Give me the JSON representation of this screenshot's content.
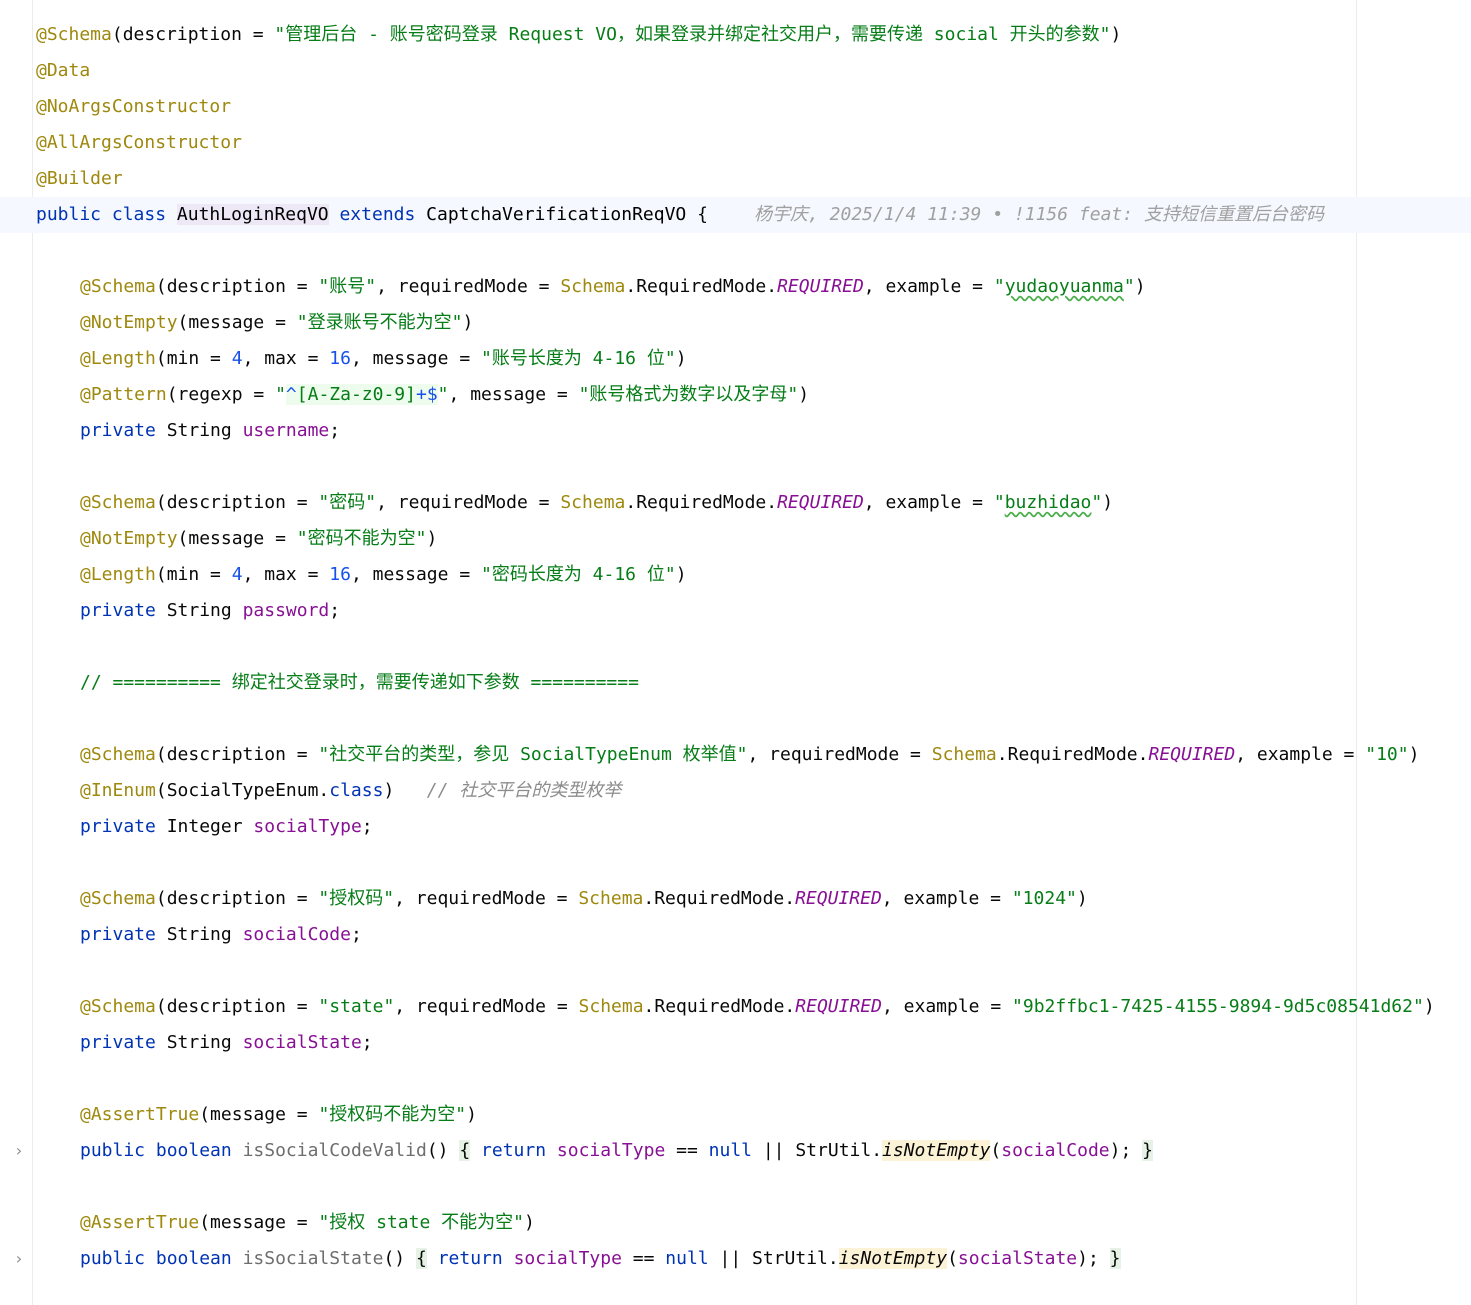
{
  "editor": {
    "lines": {
      "l1": {
        "ann": "@Schema",
        "p1": "(description = ",
        "str": "\"管理后台 - 账号密码登录 Request VO，如果登录并绑定社交用户，需要传递 social 开头的参数\"",
        "p2": ")"
      },
      "l2": {
        "ann": "@Data"
      },
      "l3": {
        "ann": "@NoArgsConstructor"
      },
      "l4": {
        "ann": "@AllArgsConstructor"
      },
      "l5": {
        "ann": "@Builder"
      },
      "l6": {
        "kw1": "public",
        "kw2": "class",
        "cls": "AuthLoginReqVO",
        "kw3": "extends",
        "parent": "CaptchaVerificationReqVO",
        "brace": "{",
        "blame": "杨宇庆, 2025/1/4 11:39 • !1156 feat: 支持短信重置后台密码"
      },
      "l8": {
        "ann": "@Schema",
        "p1": "(description = ",
        "str1": "\"账号\"",
        "p2": ", requiredMode = ",
        "schema": "Schema",
        "p3": ".RequiredMode.",
        "req": "REQUIRED",
        "p4": ", example = ",
        "q1": "\"",
        "example": "yudaoyuanma",
        "q2": "\"",
        "p5": ")"
      },
      "l9": {
        "ann": "@NotEmpty",
        "p1": "(message = ",
        "str": "\"登录账号不能为空\"",
        "p2": ")"
      },
      "l10": {
        "ann": "@Length",
        "p1": "(min = ",
        "n1": "4",
        "p2": ", max = ",
        "n2": "16",
        "p3": ", message = ",
        "str": "\"账号长度为 4-16 位\"",
        "p4": ")"
      },
      "l11": {
        "ann": "@Pattern",
        "p1": "(regexp = ",
        "q1": "\"",
        "r1": "^",
        "r2": "[A-Za-z0-9]",
        "r3": "+$",
        "q2": "\"",
        "p2": ", message = ",
        "str": "\"账号格式为数字以及字母\"",
        "p3": ")"
      },
      "l12": {
        "kw": "private",
        "type": "String",
        "field": "username",
        "semi": ";"
      },
      "l14": {
        "ann": "@Schema",
        "p1": "(description = ",
        "str1": "\"密码\"",
        "p2": ", requiredMode = ",
        "schema": "Schema",
        "p3": ".RequiredMode.",
        "req": "REQUIRED",
        "p4": ", example = ",
        "q1": "\"",
        "example": "buzhidao",
        "q2": "\"",
        "p5": ")"
      },
      "l15": {
        "ann": "@NotEmpty",
        "p1": "(message = ",
        "str": "\"密码不能为空\"",
        "p2": ")"
      },
      "l16": {
        "ann": "@Length",
        "p1": "(min = ",
        "n1": "4",
        "p2": ", max = ",
        "n2": "16",
        "p3": ", message = ",
        "str": "\"密码长度为 4-16 位\"",
        "p4": ")"
      },
      "l17": {
        "kw": "private",
        "type": "String",
        "field": "password",
        "semi": ";"
      },
      "l19": {
        "cmt": "// ========== 绑定社交登录时，需要传递如下参数 =========="
      },
      "l21": {
        "ann": "@Schema",
        "p1": "(description = ",
        "str1": "\"社交平台的类型，参见 SocialTypeEnum 枚举值\"",
        "p2": ", requiredMode = ",
        "schema": "Schema",
        "p3": ".RequiredMode.",
        "req": "REQUIRED",
        "p4": ", example = ",
        "str2": "\"10\"",
        "p5": ")"
      },
      "l22": {
        "ann": "@InEnum",
        "p1": "(SocialTypeEnum.",
        "kw": "class",
        "p2": ")",
        "cmt": "// 社交平台的类型枚举"
      },
      "l23": {
        "kw": "private",
        "type": "Integer",
        "field": "socialType",
        "semi": ";"
      },
      "l25": {
        "ann": "@Schema",
        "p1": "(description = ",
        "str1": "\"授权码\"",
        "p2": ", requiredMode = ",
        "schema": "Schema",
        "p3": ".RequiredMode.",
        "req": "REQUIRED",
        "p4": ", example = ",
        "str2": "\"1024\"",
        "p5": ")"
      },
      "l26": {
        "kw": "private",
        "type": "String",
        "field": "socialCode",
        "semi": ";"
      },
      "l28": {
        "ann": "@Schema",
        "p1": "(description = ",
        "str1": "\"state\"",
        "p2": ", requiredMode = ",
        "schema": "Schema",
        "p3": ".RequiredMode.",
        "req": "REQUIRED",
        "p4": ", example = ",
        "str2": "\"9b2ffbc1-7425-4155-9894-9d5c08541d62\"",
        "p5": ")"
      },
      "l29": {
        "kw": "private",
        "type": "String",
        "field": "socialState",
        "semi": ";"
      },
      "l31": {
        "ann": "@AssertTrue",
        "p1": "(message = ",
        "str": "\"授权码不能为空\"",
        "p2": ")"
      },
      "l32": {
        "fold": "›",
        "kw1": "public",
        "kw2": "boolean",
        "method": "isSocialCodeValid",
        "p1": "()",
        "ob": "{",
        "kw3": "return",
        "f1": "socialType",
        "p2": " == ",
        "kw4": "null",
        "p3": " || StrUtil.",
        "call": "isNotEmpty",
        "p4": "(",
        "f2": "socialCode",
        "p5": ");",
        "cb": "}"
      },
      "l34": {
        "ann": "@AssertTrue",
        "p1": "(message = ",
        "str": "\"授权 state 不能为空\"",
        "p2": ")"
      },
      "l35": {
        "fold": "›",
        "kw1": "public",
        "kw2": "boolean",
        "method": "isSocialState",
        "p1": "()",
        "ob": "{",
        "kw3": "return",
        "f1": "socialType",
        "p2": " == ",
        "kw4": "null",
        "p3": " || StrUtil.",
        "call": "isNotEmpty",
        "p4": "(",
        "f2": "socialState",
        "p5": ");",
        "cb": "}"
      }
    }
  }
}
